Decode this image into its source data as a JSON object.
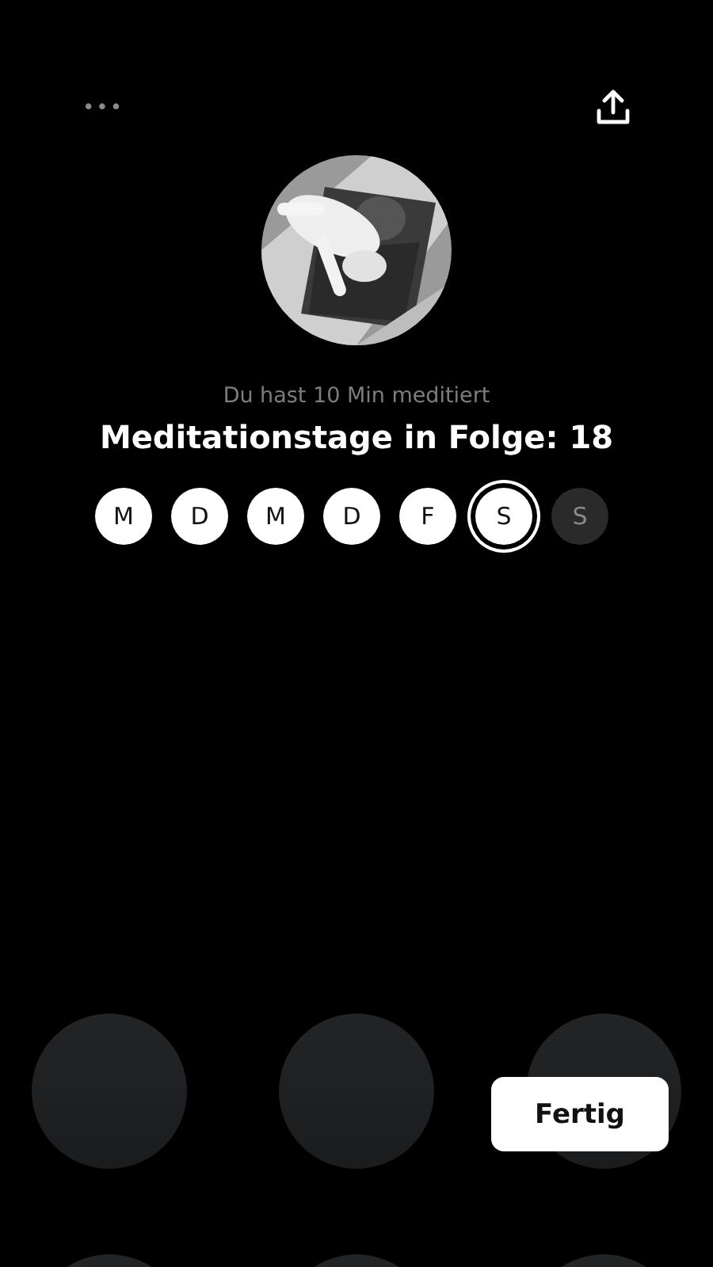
{
  "header": {
    "more": "•••"
  },
  "summary": {
    "subtitle": "Du hast 10 Min meditiert",
    "title": "Meditationstage in Folge: 18"
  },
  "days": [
    {
      "label": "M",
      "kind": "done"
    },
    {
      "label": "D",
      "kind": "done"
    },
    {
      "label": "M",
      "kind": "done"
    },
    {
      "label": "D",
      "kind": "done"
    },
    {
      "label": "F",
      "kind": "done"
    },
    {
      "label": "S",
      "kind": "today"
    },
    {
      "label": "S",
      "kind": "upcoming"
    }
  ],
  "done_button": "Fertig"
}
